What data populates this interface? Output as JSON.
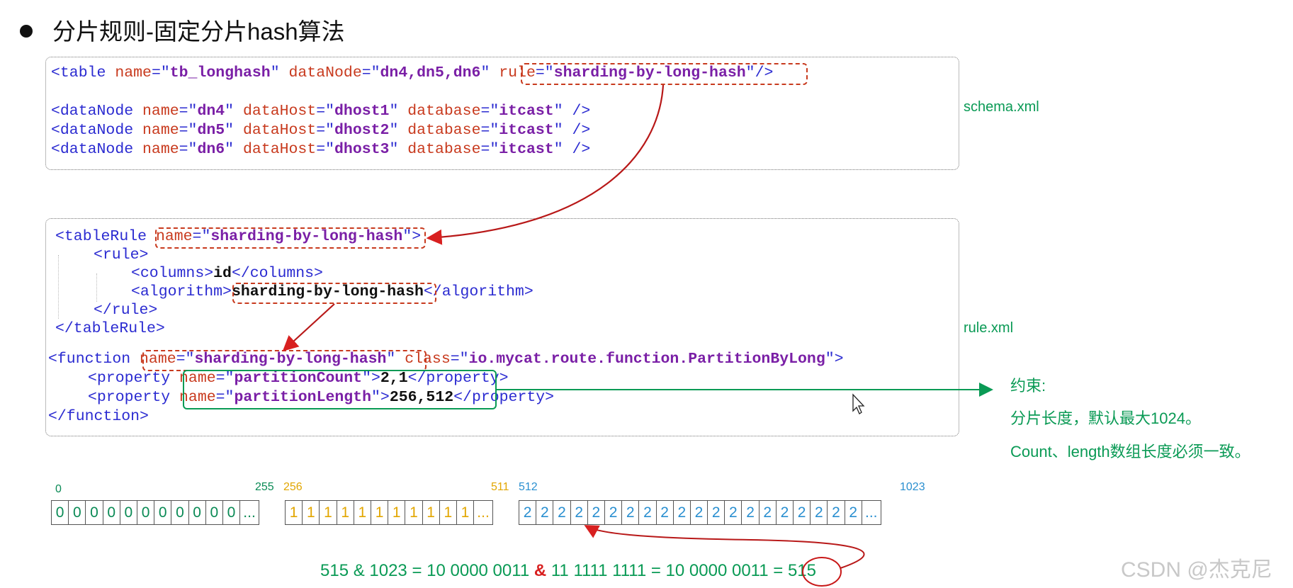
{
  "title": "分片规则-固定分片hash算法",
  "schema": {
    "file_label": "schema.xml",
    "table_line": {
      "open": "<table ",
      "attr_name": "name",
      "eq_q": "=\"",
      "name_val": "tb_longhash",
      "close_q": "\" ",
      "attr_datanode": "dataNode",
      "datanode_val": "dn4,dn5,dn6",
      "attr_rule": "rule",
      "rule_val": "sharding-by-long-hash",
      "end": "/>"
    },
    "datanodes": [
      {
        "tag": "<dataNode ",
        "name": "dn4",
        "host": "dhost1",
        "db": "itcast",
        "end": " />"
      },
      {
        "tag": "<dataNode ",
        "name": "dn5",
        "host": "dhost2",
        "db": "itcast",
        "end": " />"
      },
      {
        "tag": "<dataNode ",
        "name": "dn6",
        "host": "dhost3",
        "db": "itcast",
        "end": " />"
      }
    ],
    "attr_name": "name",
    "attr_datahost": "dataHost",
    "attr_database": "database"
  },
  "rule": {
    "file_label": "rule.xml",
    "tablerule_open": "<tableRule ",
    "tablerule_attr": "name",
    "tablerule_val": "sharding-by-long-hash",
    "rule_open": "<rule>",
    "columns_open": "<columns>",
    "columns_val": "id",
    "columns_close": "</columns>",
    "algorithm_open": "<algorithm>",
    "algorithm_val": "sharding-by-long-hash",
    "algorithm_close": "</algorithm>",
    "rule_close": "</rule>",
    "tablerule_close": "</tableRule>",
    "function_open": "<function ",
    "function_attr_name": "name",
    "function_name_val": "sharding-by-long-hash",
    "function_attr_class": "class",
    "function_class_val": "io.mycat.route.function.PartitionByLong",
    "function_end": ">",
    "property_open": "<property ",
    "property_attr": "name",
    "prop1_name": "partitionCount",
    "prop1_val": "2,1",
    "prop2_name": "partitionLength",
    "prop2_val": "256,512",
    "property_close": "</property>",
    "function_close": "</function>"
  },
  "constraint": {
    "heading": "约束:",
    "line1": "分片长度，默认最大1024。",
    "line2": "Count、length数组长度必须一致。"
  },
  "array": {
    "group0": {
      "start": "0",
      "end": "255",
      "digit": "0",
      "count": 11,
      "ellipsis": "..."
    },
    "group1": {
      "start": "256",
      "end": "511",
      "digit": "1",
      "count": 11,
      "ellipsis": "..."
    },
    "group2": {
      "start": "512",
      "end": "1023",
      "digit": "2",
      "count": 20,
      "ellipsis": "..."
    }
  },
  "formula": {
    "left": "515 & 1023 = 10 0000 0011",
    "amp": "&",
    "right": "11 1111 1111 = 10 0000 0011 =",
    "result": "515"
  },
  "colors": {
    "green": "#0a9a55",
    "red": "#c83a1e",
    "blue": "#2b2bd1",
    "purple": "#7a1fa6",
    "yellow": "#e2a600",
    "cyan": "#2a8fd0"
  },
  "watermark": "CSDN @杰克尼"
}
